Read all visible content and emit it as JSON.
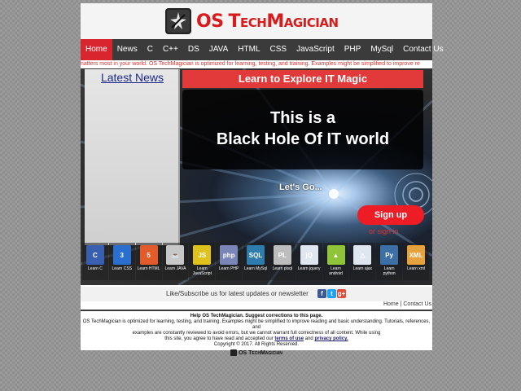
{
  "brand": {
    "logo_prefix": "OS",
    "logo_name": "TechMagician",
    "colors": {
      "primary_red": "#d9262e",
      "nav_dark": "#3b3b3b"
    }
  },
  "nav": {
    "items": [
      {
        "label": "Home",
        "active": true
      },
      {
        "label": "News"
      },
      {
        "label": "C"
      },
      {
        "label": "C++"
      },
      {
        "label": "DS"
      },
      {
        "label": "JAVA"
      },
      {
        "label": "HTML"
      },
      {
        "label": "CSS"
      },
      {
        "label": "JavaScript"
      },
      {
        "label": "PHP"
      },
      {
        "label": "MySql"
      },
      {
        "label": "Contact Us"
      }
    ]
  },
  "marquee": {
    "text": "matters most in your world. OS TechMagician is optimized for learning, testing, and training. Examples might be simplified to improve re"
  },
  "sidebar": {
    "title": "Latest News"
  },
  "hero": {
    "banner": "Learn to Explore IT Magic",
    "headline_1": "This is a",
    "headline_2": "Black Hole Of IT world",
    "lets_go": "Let's Go...",
    "signup": "Sign up",
    "signin": "or sign in"
  },
  "courses": [
    {
      "icon": "c-language-icon",
      "glyph": "C",
      "color": "#3a5fb0",
      "label_1": "Learn C",
      "label_2": ""
    },
    {
      "icon": "css-icon",
      "glyph": "3",
      "color": "#2a6fcf",
      "label_1": "Learn CSS",
      "label_2": ""
    },
    {
      "icon": "html5-icon",
      "glyph": "5",
      "color": "#e35b2a",
      "label_1": "Learn HTML",
      "label_2": ""
    },
    {
      "icon": "java-icon",
      "glyph": "☕",
      "color": "#c8c8c8",
      "label_1": "Learn JAVA",
      "label_2": ""
    },
    {
      "icon": "javascript-icon",
      "glyph": "JS",
      "color": "#e0c21c",
      "label_1": "Learn",
      "label_2": "JavaScript"
    },
    {
      "icon": "php-icon",
      "glyph": "php",
      "color": "#7a86b8",
      "label_1": "Learn PHP",
      "label_2": ""
    },
    {
      "icon": "sql-icon",
      "glyph": "SQL",
      "color": "#2e7cae",
      "label_1": "Learn MySql",
      "label_2": ""
    },
    {
      "icon": "plsql-icon",
      "glyph": "PL",
      "color": "#bdbdbd",
      "label_1": "Learn plsql",
      "label_2": ""
    },
    {
      "icon": "jquery-icon",
      "glyph": "jQ",
      "color": "#dfe6ef",
      "label_1": "Learn jquery",
      "label_2": ""
    },
    {
      "icon": "android-icon",
      "glyph": "▲",
      "color": "#8fc33a",
      "label_1": "Learn",
      "label_2": "android"
    },
    {
      "icon": "ajax-icon",
      "glyph": "△",
      "color": "#dfe6ef",
      "label_1": "Learn ajax",
      "label_2": ""
    },
    {
      "icon": "python-icon",
      "glyph": "Py",
      "color": "#3b6fa5",
      "label_1": "Learn",
      "label_2": "python"
    },
    {
      "icon": "xml-icon",
      "glyph": "XML",
      "color": "#e6a23c",
      "label_1": "Learn xml",
      "label_2": ""
    }
  ],
  "follow": {
    "text": "Like/Subscribe us for latest updates or newsletter",
    "facebook": "f",
    "twitter": "t",
    "google": "g+"
  },
  "footer_links": {
    "home": "Home",
    "separator": " | ",
    "contact": "Contact Us"
  },
  "footer": {
    "heading": "Help OS TechMagician. Suggest corrections to this page.",
    "line_1": "OS TechMagician is optimized for learning, testing, and training. Examples might be simplified to improve reading and basic understanding. Tutorials, references, and",
    "line_2": "examples are constantly reviewed to avoid errors, but we cannot warrant full correctness of all content. While using",
    "line_3_pre": "this site, you agree to have read and accepted our",
    "terms": "terms of use",
    "and": "and",
    "privacy": "privacy policy.",
    "copyright": "Copyright © 2017. All Rights Reserved.",
    "logo_text": "OS TechMagician"
  }
}
